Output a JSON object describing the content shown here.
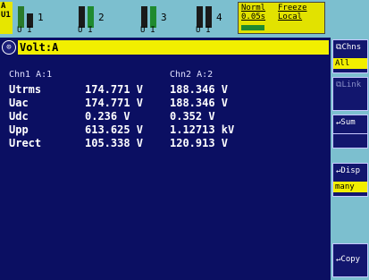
{
  "topbar": {
    "range_top": "A",
    "range_bot": "U1",
    "channels": [
      {
        "number": "1"
      },
      {
        "number": "2"
      },
      {
        "number": "3"
      },
      {
        "number": "4"
      }
    ],
    "ui_label": "UI",
    "status": {
      "mode": "Norml",
      "freeze": "Freeze",
      "cycle": "0.05s",
      "local": "Local"
    }
  },
  "title": "Volt:A",
  "table": {
    "col1_header": "Chn1 A:1",
    "col2_header": "Chn2 A:2",
    "rows": [
      {
        "label": "Utrms",
        "c1": "174.771 V",
        "c2": "188.346 V"
      },
      {
        "label": "Uac",
        "c1": "174.771 V",
        "c2": "188.346 V"
      },
      {
        "label": "Udc",
        "c1": "0.236 V",
        "c2": "0.352 V"
      },
      {
        "label": "Upp",
        "c1": "613.625 V",
        "c2": "1.12713 kV"
      },
      {
        "label": "Urect",
        "c1": "105.338 V",
        "c2": "120.913 V"
      }
    ]
  },
  "softkeys": {
    "chns": {
      "label": "Chns",
      "value": "All"
    },
    "link": {
      "label": "Link"
    },
    "sum": {
      "label": "Sum",
      "value": ""
    },
    "disp": {
      "label": "Disp",
      "value": "many"
    },
    "copy": {
      "label": "Copy"
    }
  }
}
